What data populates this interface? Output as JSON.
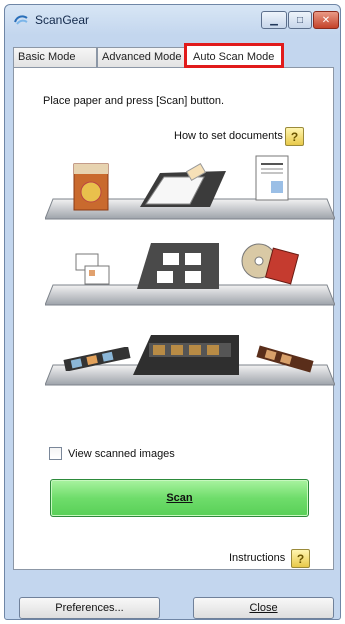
{
  "window": {
    "title": "ScanGear"
  },
  "tabs": [
    {
      "label": "Basic Mode"
    },
    {
      "label": "Advanced Mode"
    },
    {
      "label": "Auto Scan Mode"
    }
  ],
  "panel": {
    "instruction": "Place paper and press [Scan] button.",
    "how_to": "How to set documents",
    "help_glyph": "?",
    "view_scanned": "View scanned images",
    "scan_label": "Scan",
    "instructions_label": "Instructions"
  },
  "footer": {
    "preferences_label": "Preferences...",
    "close_label": "Close"
  },
  "colors": {
    "scan_button": "#6fdd6b",
    "active_tab_border": "#e11b1b",
    "close_button": "#c4432a"
  }
}
